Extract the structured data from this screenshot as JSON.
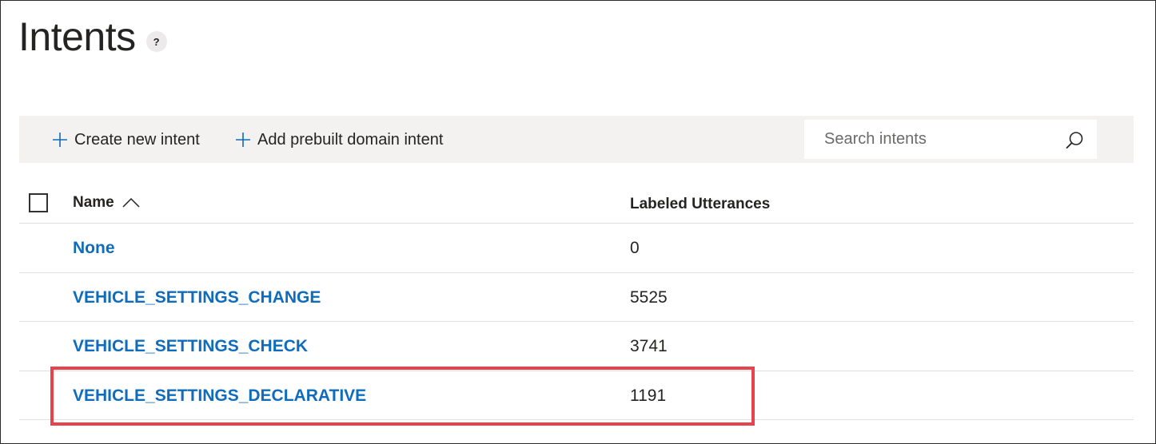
{
  "page": {
    "title": "Intents",
    "help_glyph": "?"
  },
  "toolbar": {
    "create_label": "Create new intent",
    "prebuilt_label": "Add prebuilt domain intent",
    "search_placeholder": "Search intents"
  },
  "table": {
    "columns": {
      "name": "Name",
      "utterances": "Labeled Utterances"
    },
    "rows": [
      {
        "name": "None",
        "count": "0"
      },
      {
        "name": "VEHICLE_SETTINGS_CHANGE",
        "count": "5525"
      },
      {
        "name": "VEHICLE_SETTINGS_CHECK",
        "count": "3741"
      },
      {
        "name": "VEHICLE_SETTINGS_DECLARATIVE",
        "count": "1191"
      }
    ]
  },
  "colors": {
    "accent": "#0f6cbd",
    "highlight": "#e8424a",
    "toolbar_bg": "#f3f2f1"
  },
  "icons": [
    "help-icon",
    "plus-icon",
    "search-icon",
    "sort-ascending-icon"
  ]
}
